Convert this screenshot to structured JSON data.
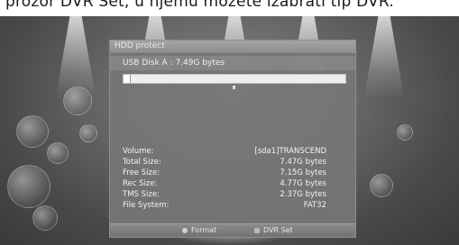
{
  "caption": {
    "text": "prozor DVR Set, u njemu možete izabrati tip DVR."
  },
  "dialog": {
    "title": "HDD protect",
    "device_label": "USB Disk A : 7.49G bytes",
    "usage_fraction": 0.03
  },
  "info_rows": [
    {
      "label": "Volume:",
      "value": "[sda1]TRANSCEND"
    },
    {
      "label": "Total Size:",
      "value": "7.47G bytes"
    },
    {
      "label": "Free Size:",
      "value": "7.15G bytes"
    },
    {
      "label": "Rec Size:",
      "value": "4.77G bytes"
    },
    {
      "label": "TMS Size:",
      "value": "2.37G bytes"
    },
    {
      "label": "File System:",
      "value": "FAT32"
    }
  ],
  "footer": {
    "format_label": "Format",
    "dvr_set_label": "DVR Set"
  },
  "colors": {
    "dialog_bg": "#767676",
    "usage_bar": "#eeeeee"
  }
}
